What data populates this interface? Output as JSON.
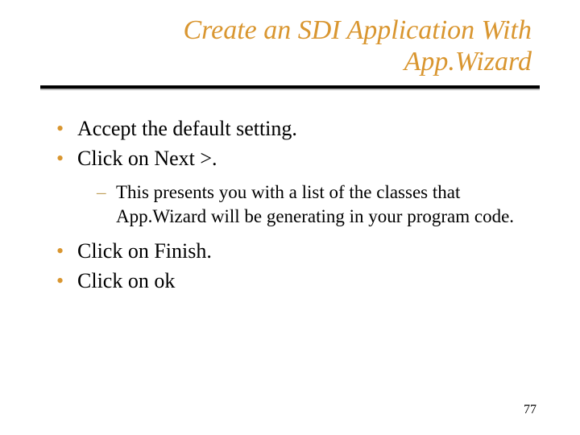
{
  "title_line1": "Create an SDI Application With",
  "title_line2": "App.Wizard",
  "bullets": {
    "b1": "Accept the default setting.",
    "b2": "Click on Next >.",
    "b2_sub1": "This presents you with a list of the classes that App.Wizard will be generating in your program code.",
    "b3": "Click on Finish.",
    "b4": "Click on ok"
  },
  "page_number": "77"
}
